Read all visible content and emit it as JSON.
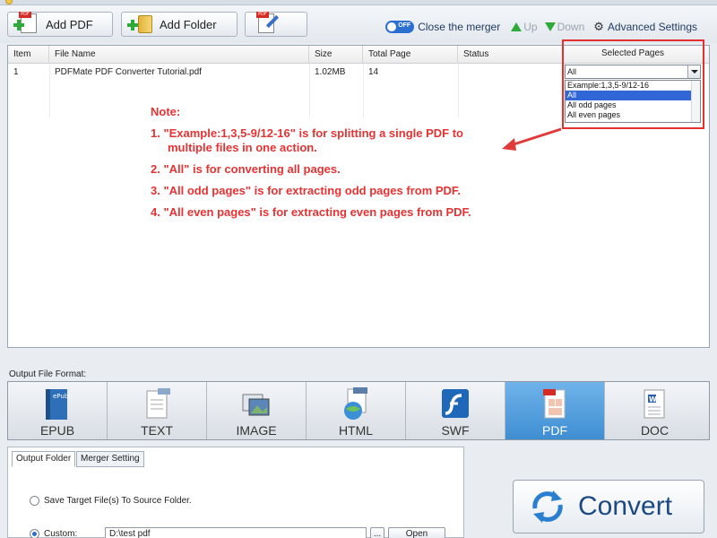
{
  "toolbar": {
    "add_pdf": "Add PDF",
    "add_folder": "Add Folder",
    "toggle_state": "OFF",
    "close_merger": "Close the merger",
    "up": "Up",
    "down": "Down",
    "advanced": "Advanced Settings"
  },
  "table": {
    "headers": [
      "Item",
      "File Name",
      "Size",
      "Total Page",
      "Status",
      "Selected Pages"
    ],
    "rows": [
      {
        "item": "1",
        "file_name": "PDFMate PDF Converter Tutorial.pdf",
        "size": "1.02MB",
        "total_page": "14",
        "status": ""
      }
    ]
  },
  "selected_pages": {
    "current": "All",
    "options": [
      "Example:1,3,5-9/12-16",
      "All",
      "All odd pages",
      "All even pages"
    ],
    "highlighted_index": 1
  },
  "note": {
    "title": "Note:",
    "lines": [
      "1. \"Example:1,3,5-9/12-16\" is for splitting a single PDF to",
      "multiple files in one action.",
      "2. \"All\" is for converting all pages.",
      "3. \"All odd pages\" is for extracting odd pages from PDF.",
      "4. \"All even pages\" is for extracting even pages from PDF."
    ]
  },
  "output_format": {
    "label": "Output File Format:",
    "formats": [
      "EPUB",
      "TEXT",
      "IMAGE",
      "HTML",
      "SWF",
      "PDF",
      "DOC"
    ],
    "active": "PDF"
  },
  "output_settings": {
    "tabs": [
      "Output Folder",
      "Merger Setting"
    ],
    "save_to_source": "Save Target File(s) To Source Folder.",
    "custom_label": "Custom:",
    "custom_path": "D:\\test pdf",
    "browse": "...",
    "open": "Open"
  },
  "convert_label": "Convert",
  "colors": {
    "note_red": "#e53333",
    "highlight_blue": "#3166d6",
    "active_format": "#4f9cdc",
    "green_arrow": "#2eaa3a"
  }
}
